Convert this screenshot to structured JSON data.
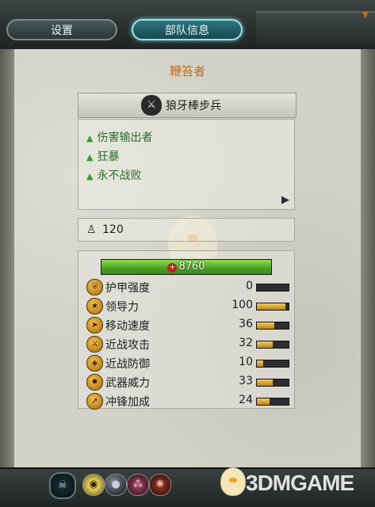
{
  "tabs": {
    "settings": "设置",
    "unit_info": "部队信息"
  },
  "unit": {
    "type_label": "鞭笞者",
    "name": "狼牙棒步兵",
    "abilities": [
      "伤害输出者",
      "狂暴",
      "永不战败"
    ],
    "count": "120",
    "hp": "8760"
  },
  "stats": [
    {
      "label": "护甲强度",
      "value": "0",
      "fraction": 0.0,
      "icon": "armor-icon"
    },
    {
      "label": "领导力",
      "value": "100",
      "fraction": 0.9,
      "icon": "leadership-icon"
    },
    {
      "label": "移动速度",
      "value": "36",
      "fraction": 0.55,
      "icon": "speed-icon"
    },
    {
      "label": "近战攻击",
      "value": "32",
      "fraction": 0.5,
      "icon": "melee-attack-icon"
    },
    {
      "label": "近战防御",
      "value": "10",
      "fraction": 0.2,
      "icon": "melee-defence-icon"
    },
    {
      "label": "武器威力",
      "value": "33",
      "fraction": 0.5,
      "icon": "weapon-strength-icon"
    },
    {
      "label": "冲锋加成",
      "value": "24",
      "fraction": 0.4,
      "icon": "charge-bonus-icon"
    }
  ],
  "watermark": "3DMGAME",
  "colors": {
    "unit_type": "#c26a1c",
    "ability": "#2c6e2a",
    "hp_bar": "#4aa024"
  }
}
